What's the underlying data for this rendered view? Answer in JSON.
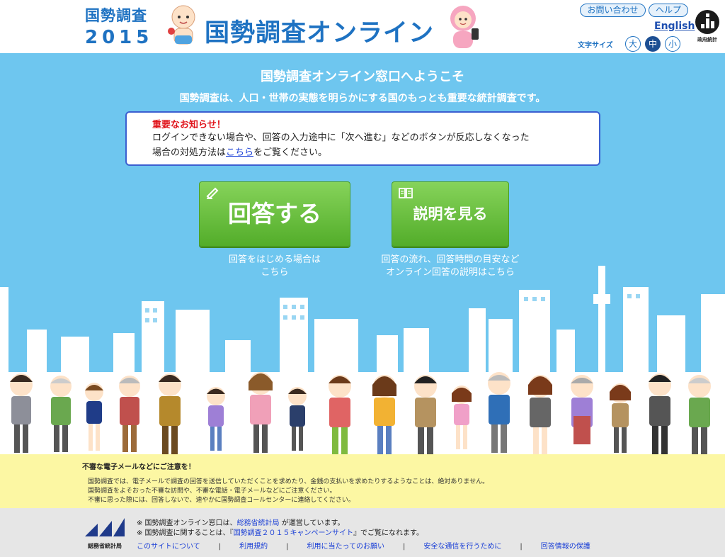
{
  "header": {
    "logo_line1": "国勢調査",
    "logo_line2": "2015",
    "title": "国勢調査オンライン",
    "contact_label": "お問い合わせ",
    "help_label": "ヘルプ",
    "english_label": "English",
    "font_size_label": "文字サイズ",
    "font_sizes": [
      "大",
      "中",
      "小"
    ],
    "font_size_selected": "中",
    "gov_stats_label": "政府統計"
  },
  "hero": {
    "welcome": "国勢調査オンライン窓口へようこそ",
    "tagline": "国勢調査は、人口・世帯の実態を明らかにする国のもっとも重要な統計調査です。",
    "notice": {
      "title": "重要なお知らせ！",
      "line1": "ログインできない場合や、回答の入力途中に「次へ進む」などのボタンが反応しなくなった",
      "line2_before": "場合の対処方法は",
      "line2_link": "こちら",
      "line2_after": "をご覧ください。"
    },
    "answer_button": "回答する",
    "answer_sub1": "回答をはじめる場合は",
    "answer_sub2": "こちら",
    "explain_button": "説明を見る",
    "explain_sub1": "回答の流れ、回答時間の目安など",
    "explain_sub2": "オンライン回答の説明はこちら"
  },
  "caution": {
    "title": "不審な電子メールなどにご注意を！",
    "lines": [
      "国勢調査では、電子メールで調査の回答を送信していただくことを求めたり、金銭の支払いを求めたりするようなことは、絶対ありません。",
      "国勢調査をよそおった不審な訪問や、不審な電話・電子メールなどにご注意ください。",
      "不審に思った際には、回答しないで、速やかに国勢調査コールセンターに連絡してください。"
    ]
  },
  "footer": {
    "ministry_label": "総務省統計局",
    "note1_before": "※ 国勢調査オンライン窓口は、",
    "note1_link": "総務省統計局",
    "note1_after": " が運営しています。",
    "note2_before": "※ 国勢調査に関することは、『",
    "note2_link": "国勢調査２０１５キャンペーンサイト",
    "note2_after": "』でご覧になれます。",
    "links": [
      "このサイトについて",
      "利用規約",
      "利用に当たってのお願い",
      "安全な通信を行うために",
      "回答情報の保護"
    ]
  },
  "colors": {
    "brand_blue": "#1e72c2",
    "sky": "#6ec6ef",
    "cta_green": "#5db534",
    "notice_red": "#e0141b",
    "caution_yellow": "#fcf7a3",
    "footer_gray": "#e6e6e6"
  }
}
